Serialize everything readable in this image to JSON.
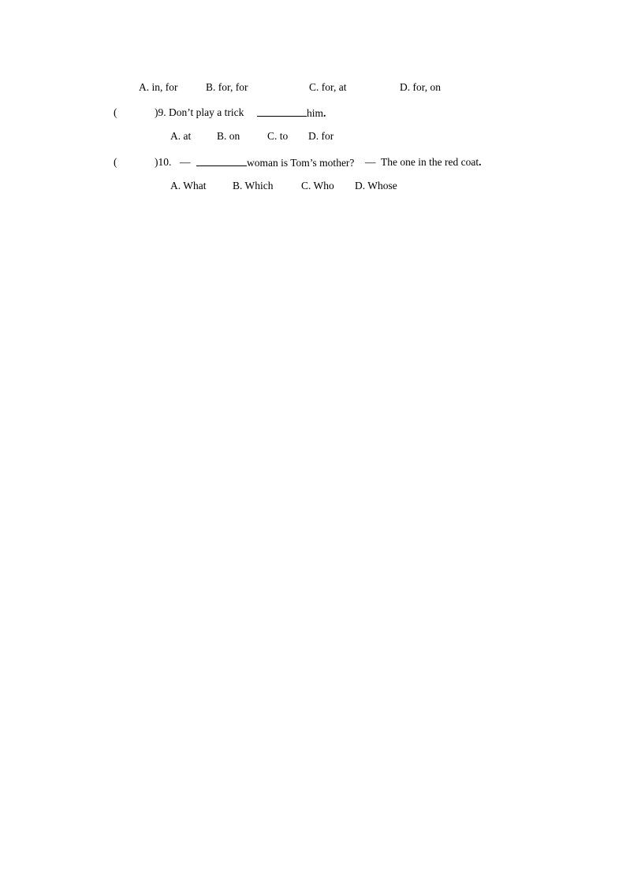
{
  "question8_options": {
    "a": "A. in, for",
    "b": "B. for, for",
    "c": "C. for, at",
    "d": "D. for, on"
  },
  "question9": {
    "paren_open": "(",
    "paren_close_number": ")9. Don’t play a trick",
    "after_blank": "him",
    "period": ".",
    "options": {
      "a": "A. at",
      "b": "B. on",
      "c": "C. to",
      "d": "D. for"
    }
  },
  "question10": {
    "paren_open": "(",
    "number": ")10.",
    "dash1": "—",
    "after_blank": "woman is Tom’s mother?",
    "dash2": "—",
    "answer": "The one in the red coat",
    "period": ".",
    "options": {
      "a": "A. What",
      "b": "B. Which",
      "c": "C. Who",
      "d": "D. Whose"
    }
  }
}
